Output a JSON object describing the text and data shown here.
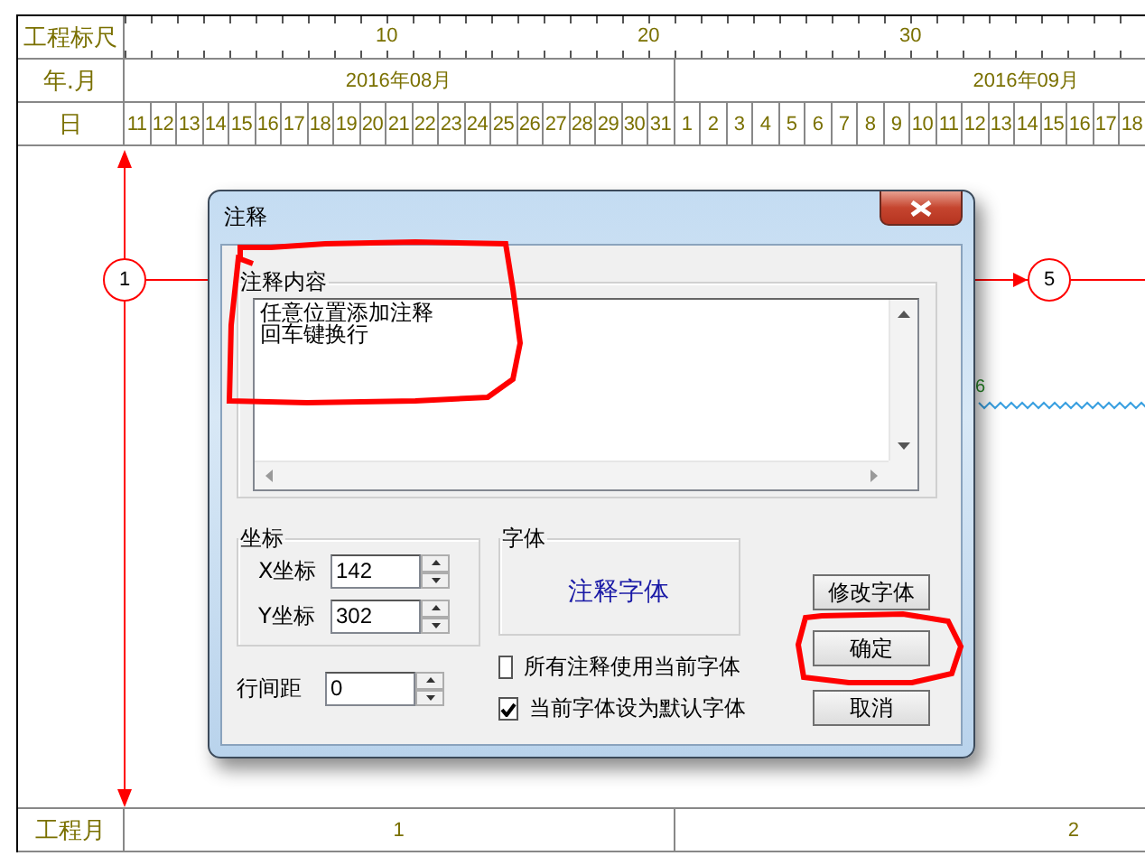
{
  "ruler": {
    "label": "工程标尺",
    "ticks": [
      "10",
      "20",
      "30"
    ]
  },
  "months_row": {
    "label": "年.月",
    "months": [
      "2016年08月",
      "2016年09月"
    ]
  },
  "days_row": {
    "label": "日",
    "days": [
      "11",
      "12",
      "13",
      "14",
      "15",
      "16",
      "17",
      "18",
      "19",
      "20",
      "21",
      "22",
      "23",
      "24",
      "25",
      "26",
      "27",
      "28",
      "29",
      "30",
      "31",
      "1",
      "2",
      "3",
      "4",
      "5",
      "6",
      "7",
      "8",
      "9",
      "10",
      "11",
      "12",
      "13",
      "14",
      "15",
      "16",
      "17",
      "18"
    ]
  },
  "network": {
    "nodes": [
      {
        "label": "1"
      },
      {
        "label": "5"
      }
    ],
    "activity_label": "6"
  },
  "dialog": {
    "title": "注释",
    "content_group": {
      "label": "注释内容",
      "lines": [
        "任意位置添加注释",
        "回车键换行"
      ]
    },
    "coords_group": {
      "label": "坐标",
      "x_label": "X坐标",
      "x_value": "142",
      "y_label": "Y坐标",
      "y_value": "302"
    },
    "font_group": {
      "label": "字体",
      "sample": "注释字体"
    },
    "line_spacing": {
      "label": "行间距",
      "value": "0"
    },
    "checkboxes": [
      {
        "label": "所有注释使用当前字体",
        "checked": false
      },
      {
        "label": "当前字体设为默认字体",
        "checked": true
      }
    ],
    "buttons": [
      "修改字体",
      "确定",
      "取消"
    ]
  },
  "bottom_row": {
    "label": "工程月",
    "months": [
      "1",
      "2"
    ]
  }
}
